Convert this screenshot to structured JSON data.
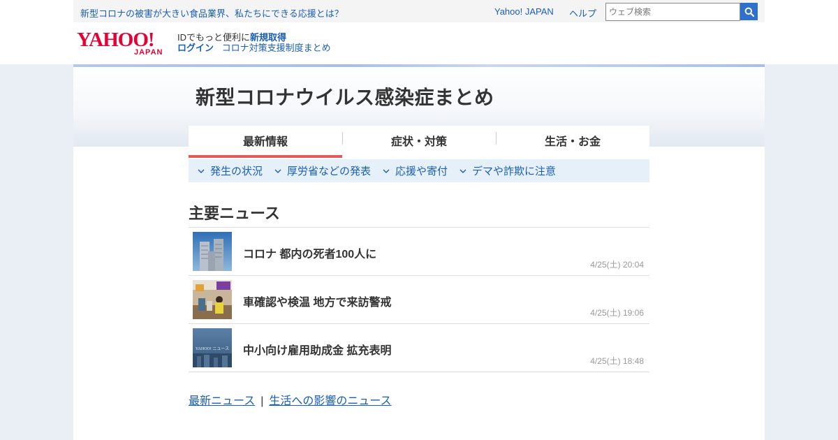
{
  "header": {
    "promo_text": "新型コロナの被害が大きい食品業界、私たちにできる応援とは？",
    "yahoo_japan_link": "Yahoo! JAPAN",
    "help_link": "ヘルプ",
    "search_placeholder": "ウェブ検索",
    "logo_text": "YAHOO!",
    "logo_subtext": "JAPAN",
    "id_prompt": "IDでもっと便利に",
    "signup_link": "新規取得",
    "login_link": "ログイン",
    "support_link": "コロナ対策支援制度まとめ"
  },
  "page": {
    "title": "新型コロナウイルス感染症まとめ"
  },
  "tabs": [
    {
      "label": "最新情報",
      "active": true
    },
    {
      "label": "症状・対策",
      "active": false
    },
    {
      "label": "生活・お金",
      "active": false
    }
  ],
  "subnav": [
    {
      "label": "発生の状況"
    },
    {
      "label": "厚労省などの発表"
    },
    {
      "label": "応援や寄付"
    },
    {
      "label": "デマや詐欺に注意"
    }
  ],
  "news": {
    "section_title": "主要ニュース",
    "items": [
      {
        "title": "コロナ 都内の死者100人に",
        "time": "4/25(土) 20:04",
        "thumb": "tokyo-govt-building"
      },
      {
        "title": "車確認や検温 地方で来訪警戒",
        "time": "4/25(土) 19:06",
        "thumb": "station-checkpoint"
      },
      {
        "title": "中小向け雇用助成金 拡充表明",
        "time": "4/25(土) 18:48",
        "thumb": "yahoo-news-placeholder"
      }
    ],
    "thumb_caption": "YAHOO! ニュース"
  },
  "footer": {
    "latest_news_link": "最新ニュース",
    "separator": "|",
    "life_impact_link": "生活への影響のニュース"
  },
  "colors": {
    "accent_red": "#e25a5a",
    "link_blue": "#1a5fb4",
    "logo_red": "#e60033",
    "subnav_bg": "#e6f0f8"
  }
}
